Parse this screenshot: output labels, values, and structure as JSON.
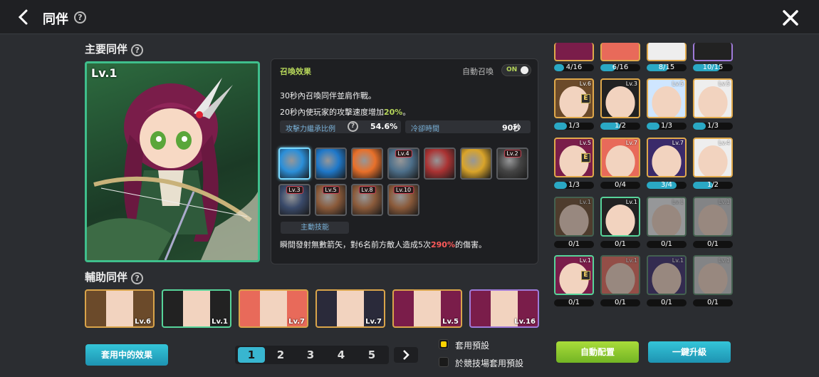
{
  "header": {
    "title": "同伴",
    "help": "?"
  },
  "main_companion": {
    "section_title": "主要同伴",
    "level": "Lv.1"
  },
  "panel": {
    "title": "召喚效果",
    "auto_summon_label": "自動召喚",
    "auto_summon_state": "ON",
    "desc_line1": "30秒內召喚同伴並肩作戰。",
    "desc_line2_a": "20秒內使玩家的攻擊速度增加",
    "desc_line2_b": "20%",
    "desc_line2_c": "。",
    "stat_inherit_label": "攻擊力繼承比例",
    "stat_inherit_value": "54.6%",
    "stat_cd_label": "冷卻時間",
    "stat_cd_value": "90秒",
    "skills": [
      {
        "icon": "ice-arrow-icon",
        "level": ""
      },
      {
        "icon": "ice-bow-icon",
        "level": ""
      },
      {
        "icon": "flame-icon",
        "level": ""
      },
      {
        "icon": "wind-blast-icon",
        "level": "Lv.4"
      },
      {
        "icon": "gauntlet-icon",
        "level": ""
      },
      {
        "icon": "golden-arrow-icon",
        "level": ""
      },
      {
        "icon": "crossbow-icon",
        "level": "Lv.2"
      },
      {
        "icon": "vortex-icon",
        "level": "Lv.3"
      },
      {
        "icon": "fox-spirit-icon",
        "level": "Lv.5"
      },
      {
        "icon": "fox-spirit-icon",
        "level": "Lv.8"
      },
      {
        "icon": "fox-spirit-icon",
        "level": "Lv.10"
      }
    ],
    "active_skill_label": "主動技能",
    "skill_desc_a": "瞬間發射無數箭矢，對6名前方敵人造成5次",
    "skill_desc_b": "290%",
    "skill_desc_c": "的傷害。"
  },
  "sub_companions": {
    "section_title": "輔助同伴",
    "items": [
      {
        "level": "Lv.6",
        "color": "#d9a44a"
      },
      {
        "level": "Lv.1",
        "color": "#57d49a"
      },
      {
        "level": "Lv.7",
        "color": "#d9a44a"
      },
      {
        "level": "Lv.7",
        "color": "#d9a44a"
      },
      {
        "level": "Lv.5",
        "color": "#d9a44a"
      },
      {
        "level": "Lv.16",
        "color": "#9f7ad9"
      }
    ]
  },
  "buttons": {
    "effects": "套用中的效果",
    "auto_arrange": "自動配置",
    "upgrade_all": "一鍵升級"
  },
  "pager": {
    "pages": [
      "1",
      "2",
      "3",
      "4",
      "5"
    ],
    "current": "1"
  },
  "presets": {
    "apply": "套用預設",
    "arena": "於競技場套用預設"
  },
  "grid": {
    "row0": [
      "4/16",
      "6/16",
      "8/15",
      "10/15"
    ],
    "row1": [
      {
        "lv": "Lv.6",
        "e": true,
        "bar": "1/3",
        "fill": 0.33
      },
      {
        "lv": "Lv.3",
        "e": false,
        "bar": "1/2",
        "fill": 0.5
      },
      {
        "lv": "Lv.5",
        "e": false,
        "bar": "1/3",
        "fill": 0.33
      },
      {
        "lv": "Lv.5",
        "e": false,
        "bar": "1/3",
        "fill": 0.33
      }
    ],
    "row2": [
      {
        "lv": "Lv.5",
        "e": true,
        "bar": "1/3",
        "fill": 0.33
      },
      {
        "lv": "Lv.7",
        "e": false,
        "bar": "0/4",
        "fill": 0
      },
      {
        "lv": "Lv.7",
        "e": false,
        "bar": "3/4",
        "fill": 0.75
      },
      {
        "lv": "Lv.4",
        "e": false,
        "bar": "1/2",
        "fill": 0.5
      }
    ],
    "row3": [
      {
        "lv": "Lv.1",
        "e": false,
        "bar": "0/1",
        "fill": 0
      },
      {
        "lv": "Lv.1",
        "e": false,
        "bar": "0/1",
        "fill": 0
      },
      {
        "lv": "Lv.1",
        "e": false,
        "bar": "0/1",
        "fill": 0
      },
      {
        "lv": "Lv.1",
        "e": false,
        "bar": "0/1",
        "fill": 0
      }
    ],
    "row4": [
      {
        "lv": "Lv.1",
        "e": true,
        "bar": "0/1",
        "fill": 0
      },
      {
        "lv": "Lv.1",
        "e": false,
        "bar": "0/1",
        "fill": 0
      },
      {
        "lv": "Lv.1",
        "e": false,
        "bar": "0/1",
        "fill": 0
      },
      {
        "lv": "Lv.1",
        "e": false,
        "bar": "0/1",
        "fill": 0
      }
    ]
  }
}
